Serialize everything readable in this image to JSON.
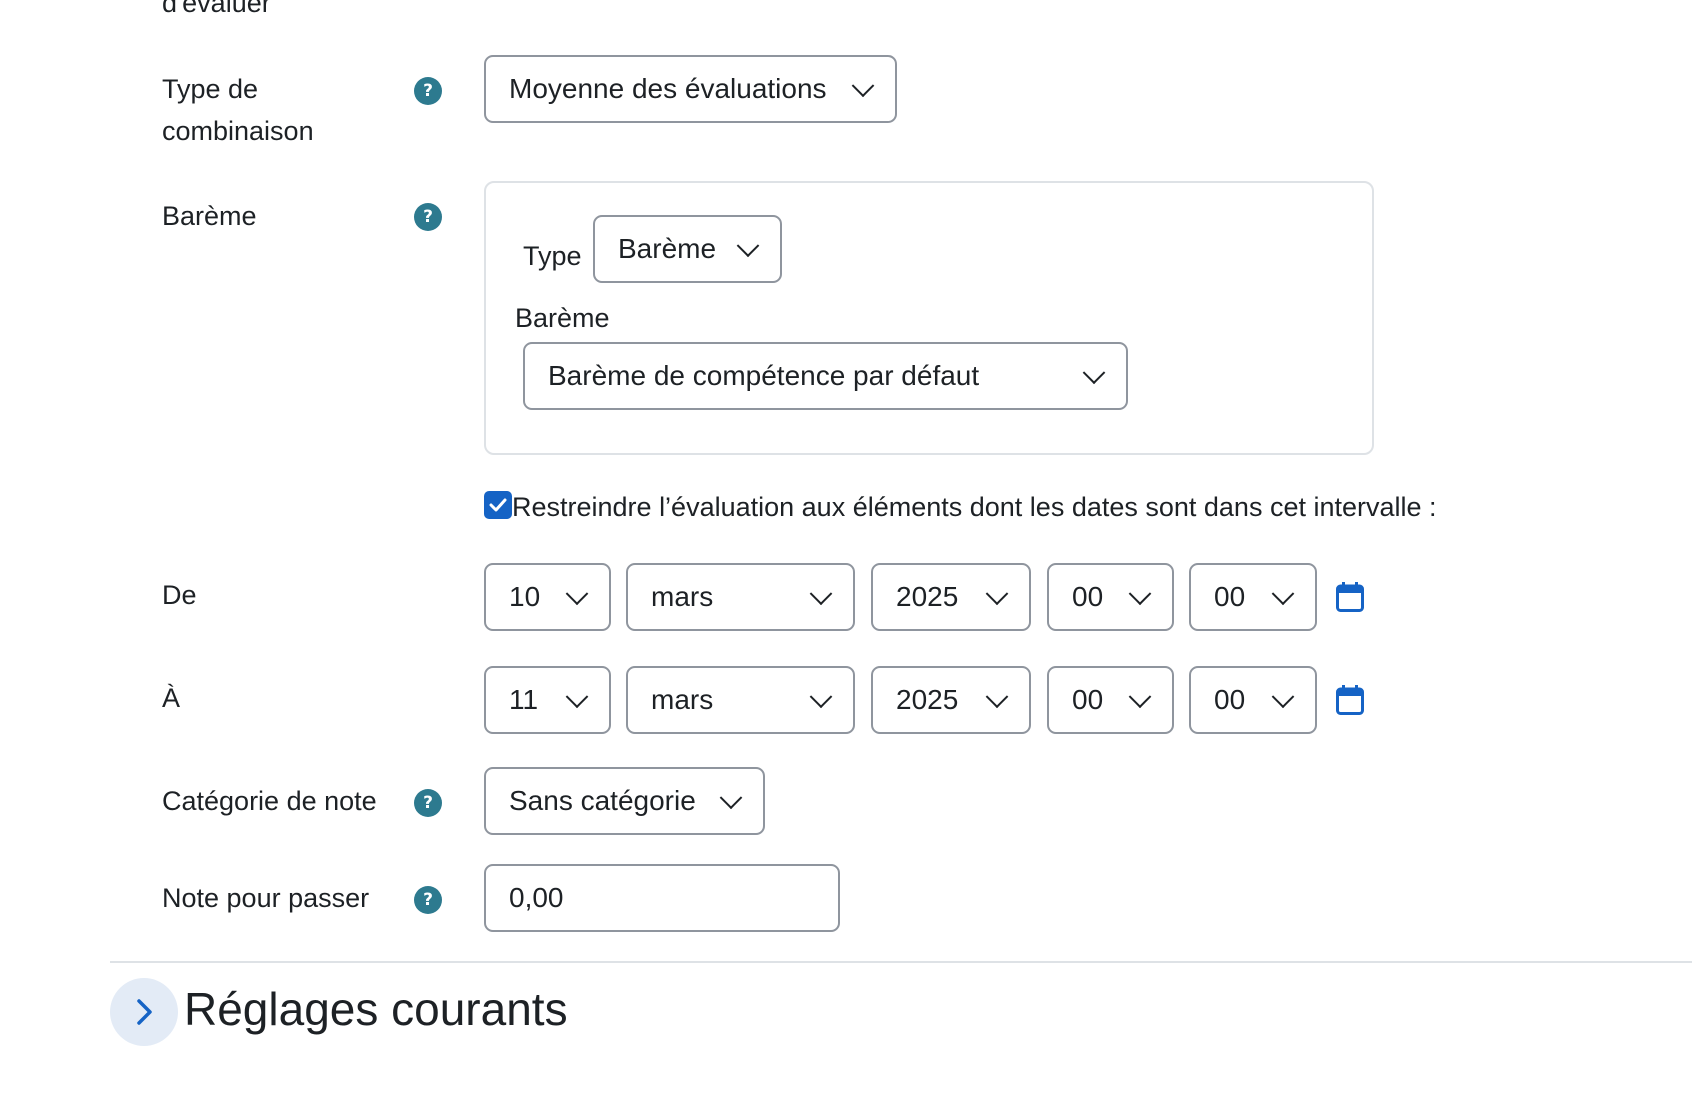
{
  "form": {
    "partial_label_top": "d'évaluer",
    "combination": {
      "label_line1": "Type de",
      "label_line2": "combinaison",
      "selected": "Moyenne des évaluations"
    },
    "scale": {
      "label": "Barème",
      "type_label": "Type",
      "type_selected": "Barème",
      "scale_label": "Barème",
      "scale_selected": "Barème de compétence par défaut"
    },
    "restrict": {
      "checked": true,
      "label": "Restreindre l’évaluation aux éléments dont les dates sont dans cet intervalle :"
    },
    "from": {
      "label": "De",
      "day": "10",
      "month": "mars",
      "year": "2025",
      "hour": "00",
      "minute": "00"
    },
    "to": {
      "label": "À",
      "day": "11",
      "month": "mars",
      "year": "2025",
      "hour": "00",
      "minute": "00"
    },
    "grade_category": {
      "label": "Catégorie de note",
      "selected": "Sans catégorie"
    },
    "grade_pass": {
      "label": "Note pour passer",
      "value": "0,00"
    }
  },
  "section": {
    "title": "Réglages courants"
  },
  "icons": {
    "help": "question-circle-icon",
    "calendar": "calendar-icon",
    "chevron": "chevron-down-icon",
    "expand": "chevron-right-icon"
  },
  "colors": {
    "help": "#2d7a8f",
    "checkbox": "#1563c5",
    "calendar": "#1563c5"
  }
}
